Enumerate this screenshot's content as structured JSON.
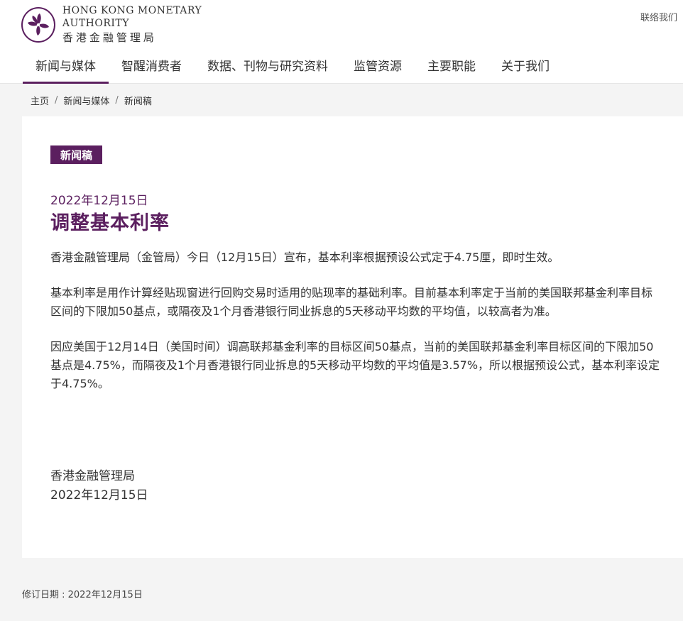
{
  "header": {
    "logo_en": "HONG KONG MONETARY AUTHORITY",
    "logo_zh": "香港金融管理局",
    "contact": "联络我们"
  },
  "nav": {
    "items": [
      {
        "label": "新闻与媒体"
      },
      {
        "label": "智醒消费者"
      },
      {
        "label": "数据、刊物与研究资料"
      },
      {
        "label": "监管资源"
      },
      {
        "label": "主要职能"
      },
      {
        "label": "关于我们"
      }
    ],
    "active_index": 0
  },
  "breadcrumb": {
    "items": [
      "主页",
      "新闻与媒体",
      "新闻稿"
    ],
    "separator": "/"
  },
  "article": {
    "tag": "新闻稿",
    "date": "2022年12月15日",
    "title": "调整基本利率",
    "paragraphs": [
      "香港金融管理局（金管局）今日（12月15日）宣布，基本利率根据预设公式定于4.75厘，即时生效。",
      "基本利率是用作计算经贴现窗进行回购交易时适用的贴现率的基础利率。目前基本利率定于当前的美国联邦基金利率目标区间的下限加50基点，或隔夜及1个月香港银行同业拆息的5天移动平均数的平均值，以较高者为准。",
      "因应美国于12月14日（美国时间）调高联邦基金利率的目标区间50基点，当前的美国联邦基金利率目标区间的下限加50基点是4.75%，而隔夜及1个月香港银行同业拆息的5天移动平均数的平均值是3.57%，所以根据预设公式，基本利率设定于4.75%。"
    ],
    "sign_org": "香港金融管理局",
    "sign_date": "2022年12月15日"
  },
  "footer": {
    "revised": "修订日期 : 2022年12月15日"
  },
  "colors": {
    "brand": "#5b1f5f",
    "background": "#f4f4f4"
  },
  "icons": {
    "logo": "bauhinia-emblem-icon"
  }
}
